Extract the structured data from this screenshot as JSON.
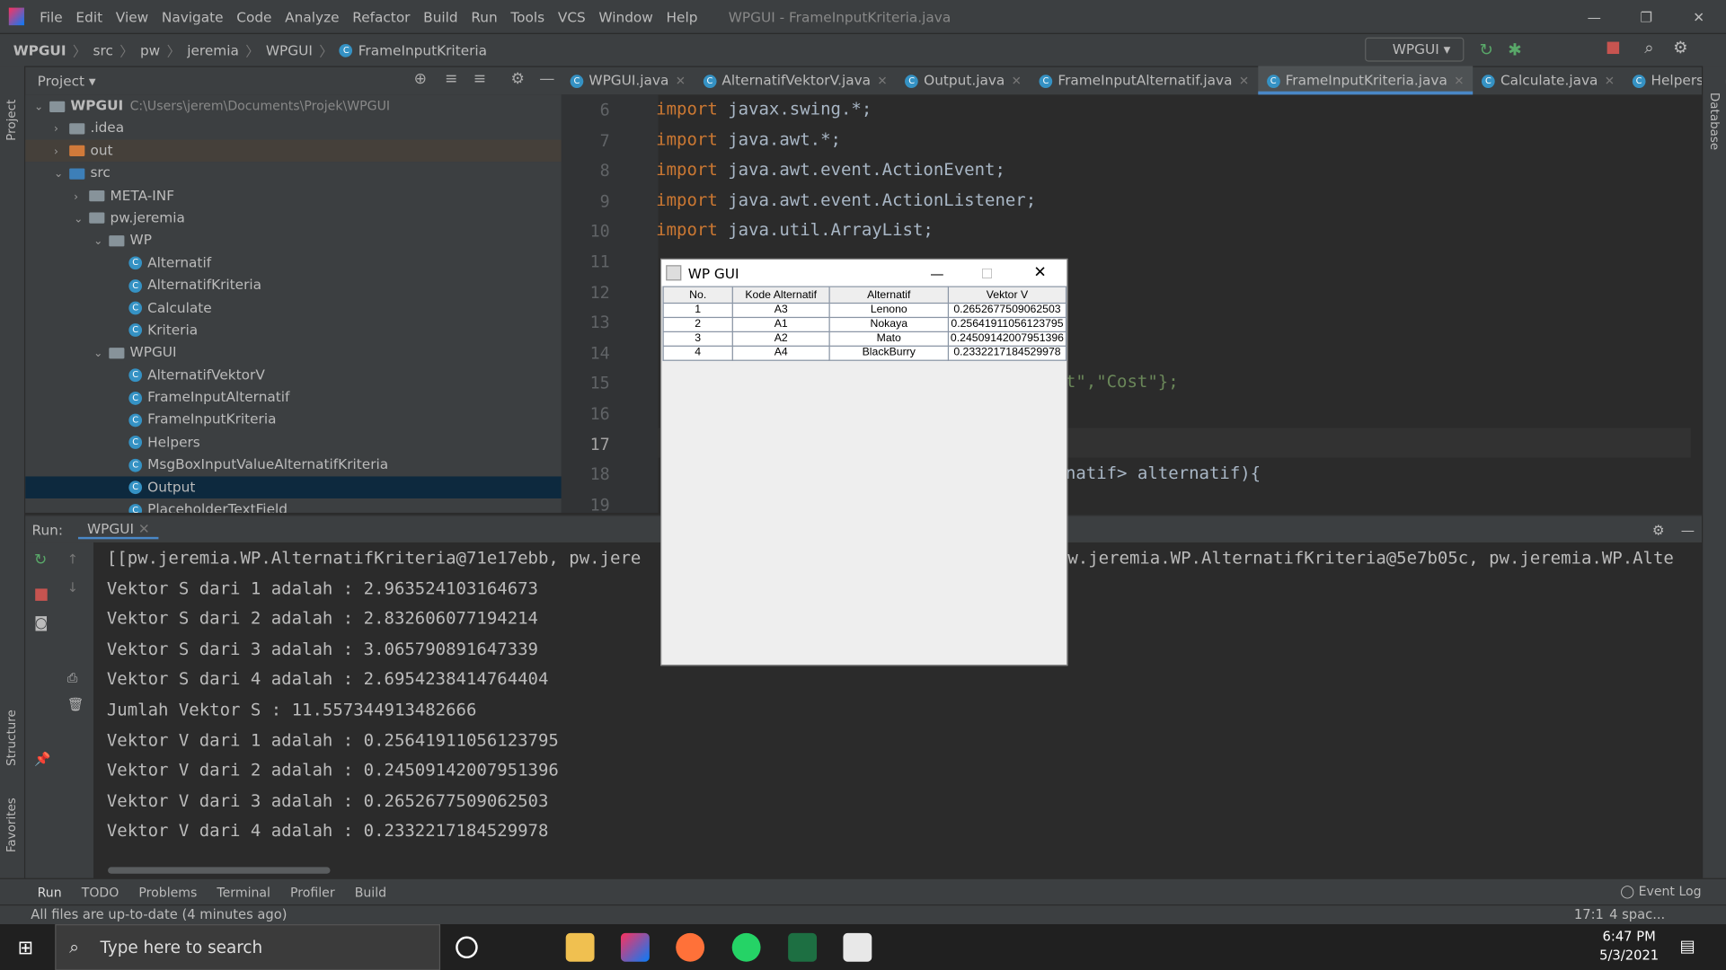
{
  "window_title": "WPGUI - FrameInputKriteria.java",
  "menu": [
    "File",
    "Edit",
    "View",
    "Navigate",
    "Code",
    "Analyze",
    "Refactor",
    "Build",
    "Run",
    "Tools",
    "VCS",
    "Window",
    "Help"
  ],
  "breadcrumb": [
    "WPGUI",
    "src",
    "pw",
    "jeremia",
    "WPGUI",
    "FrameInputKriteria"
  ],
  "run_config": "WPGUI",
  "project_label": "Project",
  "tabs": [
    "WPGUI.java",
    "AlternatifVektorV.java",
    "Output.java",
    "FrameInputAlternatif.java",
    "FrameInputKriteria.java",
    "Calculate.java",
    "Helpers.java"
  ],
  "active_tab": "FrameInputKriteria.java",
  "tree": [
    {
      "label": "WPGUI",
      "path": "C:\\Users\\jerem\\Documents\\Projek\\WPGUI",
      "depth": 0,
      "arrow": "v",
      "type": "module"
    },
    {
      "label": ".idea",
      "depth": 1,
      "arrow": ">",
      "type": "folder"
    },
    {
      "label": "out",
      "depth": 1,
      "arrow": ">",
      "type": "folder-orange"
    },
    {
      "label": "src",
      "depth": 1,
      "arrow": "v",
      "type": "folder-blue"
    },
    {
      "label": "META-INF",
      "depth": 2,
      "arrow": ">",
      "type": "folder"
    },
    {
      "label": "pw.jeremia",
      "depth": 2,
      "arrow": "v",
      "type": "package"
    },
    {
      "label": "WP",
      "depth": 3,
      "arrow": "v",
      "type": "package"
    },
    {
      "label": "Alternatif",
      "depth": 4,
      "type": "class"
    },
    {
      "label": "AlternatifKriteria",
      "depth": 4,
      "type": "class"
    },
    {
      "label": "Calculate",
      "depth": 4,
      "type": "class"
    },
    {
      "label": "Kriteria",
      "depth": 4,
      "type": "class"
    },
    {
      "label": "WPGUI",
      "depth": 3,
      "arrow": "v",
      "type": "package"
    },
    {
      "label": "AlternatifVektorV",
      "depth": 4,
      "type": "class"
    },
    {
      "label": "FrameInputAlternatif",
      "depth": 4,
      "type": "class"
    },
    {
      "label": "FrameInputKriteria",
      "depth": 4,
      "type": "class"
    },
    {
      "label": "Helpers",
      "depth": 4,
      "type": "class"
    },
    {
      "label": "MsgBoxInputValueAlternatifKriteria",
      "depth": 4,
      "type": "class"
    },
    {
      "label": "Output",
      "depth": 4,
      "type": "class",
      "selected": true
    },
    {
      "label": "PlaceholderTextField",
      "depth": 4,
      "type": "class"
    }
  ],
  "line_numbers": [
    "6",
    "7",
    "8",
    "9",
    "10",
    "11",
    "12",
    "13",
    "14",
    "15",
    "16",
    "17",
    "18",
    "19"
  ],
  "code_lines": [
    {
      "kw": "import",
      "rest": " javax.swing.*;"
    },
    {
      "kw": "import",
      "rest": " java.awt.*;"
    },
    {
      "kw": "import",
      "rest": " java.awt.event.ActionEvent;"
    },
    {
      "kw": "import",
      "rest": " java.awt.event.ActionListener;"
    },
    {
      "kw": "import",
      "rest": " java.util.ArrayList;"
    },
    {
      "kw": "",
      "rest": ""
    },
    {
      "kw": "",
      "rest": ""
    },
    {
      "kw": "",
      "rest": ""
    },
    {
      "kw": "",
      "rest": ""
    },
    {
      "kw": "",
      "rest": "t\",\"Cost\"};"
    },
    {
      "kw": "",
      "rest": ""
    },
    {
      "kw": "",
      "rest": ""
    },
    {
      "kw": "",
      "rest": "natif> alternatif){"
    },
    {
      "kw": "",
      "rest": ""
    }
  ],
  "run": {
    "label": "Run:",
    "tab": "WPGUI"
  },
  "console": [
    "[[pw.jeremia.WP.AlternatifKriteria@71e17ebb, pw.jere",
    "Vektor S dari 1 adalah : 2.963524103164673",
    "Vektor S dari 2 adalah : 2.832606077194214",
    "Vektor S dari 3 adalah : 3.065790891647339",
    "Vektor S dari 4 adalah : 2.6954238414764404",
    "Jumlah Vektor S : 11.557344913482666",
    "Vektor V dari 1 adalah : 0.25641911056123795",
    "Vektor V dari 2 adalah : 0.24509142007951396",
    "Vektor V dari 3 adalah : 0.2652677509062503",
    "Vektor V dari 4 adalah : 0.2332217184529978"
  ],
  "console_first_line_tail": "w.jeremia.WP.AlternatifKriteria@5e7b05c, pw.jeremia.WP.Alte",
  "bottom_tools": [
    "Run",
    "TODO",
    "Problems",
    "Terminal",
    "Profiler",
    "Build"
  ],
  "event_log": "Event Log",
  "status": {
    "message": "All files are up-to-date (4 minutes ago)",
    "position": "17:1",
    "indent": "4 spac..."
  },
  "dialog": {
    "title": "WP GUI",
    "columns": [
      "No.",
      "Kode Alternatif",
      "Alternatif",
      "Vektor V"
    ],
    "rows": [
      [
        "1",
        "A3",
        "Lenono",
        "0.2652677509062503"
      ],
      [
        "2",
        "A1",
        "Nokaya",
        "0.25641911056123795"
      ],
      [
        "3",
        "A2",
        "Mato",
        "0.24509142007951396"
      ],
      [
        "4",
        "A4",
        "BlackBurry",
        "0.2332217184529978"
      ]
    ]
  },
  "side_labels": {
    "project": "Project",
    "structure": "Structure",
    "favorites": "Favorites",
    "database": "Database"
  },
  "taskbar": {
    "search_placeholder": "Type here to search",
    "time": "6:47 PM",
    "date": "5/3/2021"
  }
}
